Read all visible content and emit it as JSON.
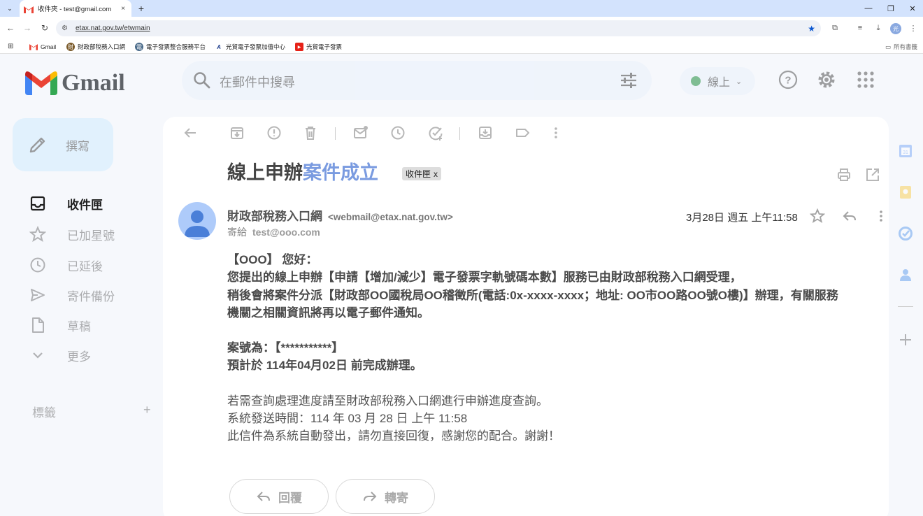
{
  "browser": {
    "tab_title": "收件夾 - test@gmail.com",
    "tab_close": "×",
    "new_tab": "+",
    "url": "etax.nat.gov.tw/etwmain",
    "bookmarks": [
      {
        "label": "Gmail",
        "icon": "gmail-icon"
      },
      {
        "label": "財政部稅務入口網",
        "icon": "tax-portal-icon"
      },
      {
        "label": "電子發票整合服務平台",
        "icon": "einvoice-platform-icon"
      },
      {
        "label": "光貿電子發票加值中心",
        "icon": "value-center-icon"
      },
      {
        "label": "光貿電子發票",
        "icon": "youtube-icon"
      }
    ],
    "all_bookmarks": "所有書籤",
    "profile_initial": "光",
    "colors": {
      "tabstrip": "#d3e3fd",
      "star": "#0b57d0"
    }
  },
  "gmail": {
    "logo_text": "Gmail",
    "search_placeholder": "在郵件中搜尋",
    "status_label": "線上",
    "compose_label": "撰寫",
    "nav": [
      {
        "label": "收件匣",
        "icon": "inbox-icon",
        "active": true
      },
      {
        "label": "已加星號",
        "icon": "star-icon",
        "active": false
      },
      {
        "label": "已延後",
        "icon": "clock-icon",
        "active": false
      },
      {
        "label": "寄件備份",
        "icon": "send-icon",
        "active": false
      },
      {
        "label": "草稿",
        "icon": "draft-icon",
        "active": false
      },
      {
        "label": "更多",
        "icon": "chevron-down-icon",
        "active": false
      }
    ],
    "labels_header": "標籤",
    "labels_add": "+"
  },
  "message": {
    "subject_part1": "線上申辦",
    "subject_part2": "案件成立",
    "label_chip": "收件匣",
    "label_chip_remove": "x",
    "sender_name": "財政部稅務入口網",
    "sender_email": "<webmail@etax.nat.gov.tw>",
    "to_prefix": "寄給",
    "to_address": "test@ooo.com",
    "date": "3月28日 週五 上午11:58",
    "body": {
      "greeting": "【OOO】  您好：",
      "line1": "您提出的線上申辦【申請【增加/減少】電子發票字軌號碼本數】服務已由財政部稅務入口網受理，",
      "line2": "稍後會將案件分派【財政部OO國稅局OO稽徵所(電話:0x-xxxx-xxxx；地址: OO市OO路OO號O樓)】辦理，有關服務機關之相關資訊將再以電子郵件通知。",
      "case_no": "案號為：【***********】",
      "eta": "預計於 114年04月02日 前完成辦理。",
      "note1": "若需查詢處理進度請至財政部稅務入口網進行申辦進度查詢。",
      "note2": "系統發送時間：114 年 03 月 28 日 上午 11:58",
      "note3": "此信件為系統自動發出，請勿直接回復，感謝您的配合。謝謝！"
    },
    "reply_label": "回覆",
    "forward_label": "轉寄"
  }
}
